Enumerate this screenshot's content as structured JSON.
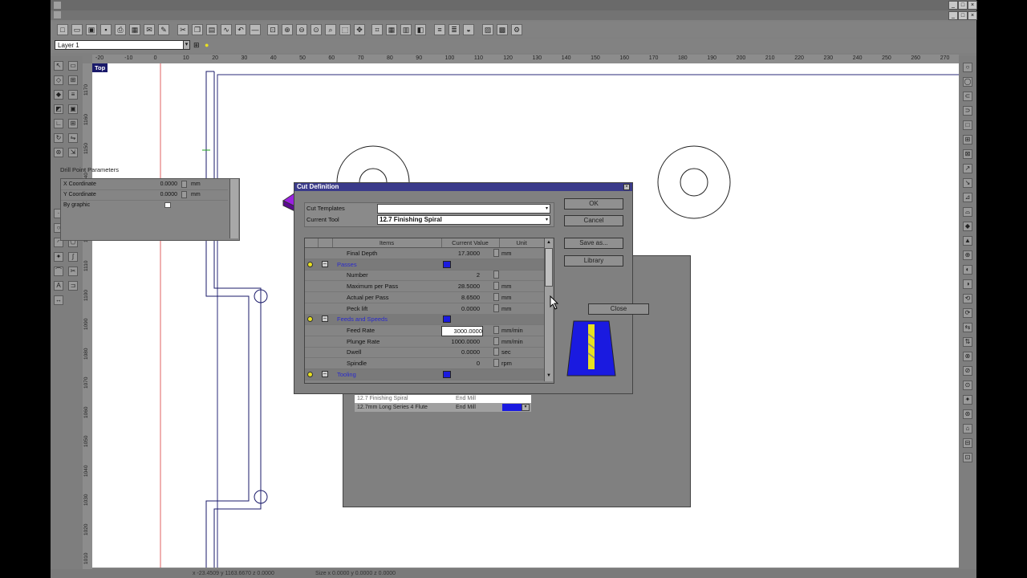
{
  "app": {
    "title": "",
    "menu_title": "",
    "layer": "Layer 1",
    "viewport_label": "Top",
    "status_left": "x -23.4509 y 1163.6670 z 0.0000",
    "status_right": "Size x 0.0000 y 0.0000 z 0.0000"
  },
  "ruler": {
    "top_ticks": [
      "-20",
      "-10",
      "0",
      "10",
      "20",
      "30",
      "40",
      "50",
      "60",
      "70",
      "80",
      "90",
      "100",
      "110",
      "120",
      "130",
      "140",
      "150",
      "160",
      "170",
      "180",
      "190",
      "200",
      "210",
      "220",
      "230",
      "240",
      "250",
      "260",
      "270"
    ],
    "left_ticks": [
      "1170",
      "1160",
      "1150",
      "1140",
      "1130",
      "1120",
      "1110",
      "1100",
      "1090",
      "1080",
      "1070",
      "1060",
      "1050",
      "1040",
      "1030",
      "1020",
      "1010"
    ]
  },
  "cut_definition": {
    "title": "Cut Definition",
    "cut_templates_label": "Cut Templates",
    "cut_templates_value": "",
    "current_tool_label": "Current Tool",
    "current_tool_value": "12.7 Finishing Spiral",
    "buttons": {
      "ok": "OK",
      "cancel": "Cancel",
      "save_as": "Save as...",
      "library": "Library",
      "close": "Close"
    },
    "headers": {
      "items": "Items",
      "current_value": "Current Value",
      "unit": "Unit"
    },
    "rows": [
      {
        "type": "item",
        "label": "Final Depth",
        "value": "17.3000",
        "unit": "mm"
      },
      {
        "type": "group",
        "label": "Passes"
      },
      {
        "type": "item",
        "label": "Number",
        "value": "2",
        "unit": ""
      },
      {
        "type": "item",
        "label": "Maximum per Pass",
        "value": "28.5000",
        "unit": "mm"
      },
      {
        "type": "item",
        "label": "Actual per Pass",
        "value": "8.6500",
        "unit": "mm"
      },
      {
        "type": "item",
        "label": "Peck lift",
        "value": "0.0000",
        "unit": "mm"
      },
      {
        "type": "group",
        "label": "Feeds and Speeds"
      },
      {
        "type": "item",
        "label": "Feed Rate",
        "value": "3000.0000",
        "unit": "mm/min",
        "editing": true
      },
      {
        "type": "item",
        "label": "Plunge Rate",
        "value": "1000.0000",
        "unit": "mm/min"
      },
      {
        "type": "item",
        "label": "Dwell",
        "value": "0.0000",
        "unit": "sec"
      },
      {
        "type": "item",
        "label": "Spindle",
        "value": "0",
        "unit": "rpm"
      },
      {
        "type": "group",
        "label": "Tooling"
      }
    ]
  },
  "background_dialog": {
    "tool_row_1_name": "12.7 Finishing Spiral",
    "tool_row_1_type": "End Mill",
    "tool_row_2_name": "12.7mm Long Series 4 Flute",
    "tool_row_2_type": "End Mill",
    "drill_section_title": "Drill Point Parameters",
    "drill_rows": [
      {
        "label": "X Coordinate",
        "value": "0.0000",
        "unit": "mm"
      },
      {
        "label": "Y Coordinate",
        "value": "0.0000",
        "unit": "mm"
      },
      {
        "label": "By graphic",
        "value": "",
        "unit": ""
      }
    ]
  },
  "colors": {
    "title_bar": "#3a3a8a",
    "tool_blue": "#1a1ae0",
    "tool_yellow": "#e8e020",
    "purple": "#9a20e0"
  }
}
